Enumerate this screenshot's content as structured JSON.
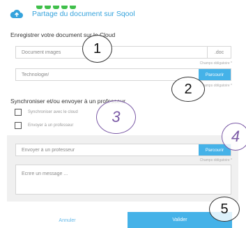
{
  "header": {
    "title": "Partage du document sur Sqool",
    "icon": "cloud-upload-icon"
  },
  "save_section": {
    "title": "Enregistrer votre document sur le Cloud",
    "doc_field": {
      "value": "Document images",
      "extension": ".doc"
    },
    "folder_field": {
      "value": "Technologie/",
      "browse_label": "Parcourir"
    },
    "required_label": "Champs obligatoire *"
  },
  "share_section": {
    "title": "Synchroniser et/ou envoyer à un professeur",
    "options": [
      "Synchroniser avec le cloud",
      "Envoyer à un professeur"
    ]
  },
  "teacher_panel": {
    "teacher_field": {
      "placeholder": "Envoyer à un professeur",
      "browse_label": "Parcourir"
    },
    "required_label": "Champs obligatoire *",
    "message_placeholder": "Ecrire un message ..."
  },
  "footer": {
    "cancel_label": "Annuler",
    "ok_label": "Valider"
  },
  "callouts": [
    "1",
    "2",
    "3",
    "4",
    "5"
  ],
  "colors": {
    "accent": "#45b2e8",
    "logo_green": "#3fbf4a",
    "callout_purple": "#7b5aa6"
  }
}
